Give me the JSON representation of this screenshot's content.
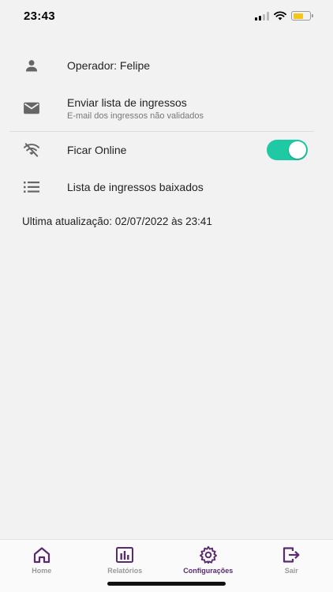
{
  "status_bar": {
    "time": "23:43"
  },
  "settings": {
    "operator": {
      "label": "Operador: Felipe",
      "icon": "person-icon"
    },
    "send_list": {
      "title": "Enviar lista de ingressos",
      "subtitle": "E-mail dos ingressos não validados",
      "icon": "mail-icon"
    },
    "stay_online": {
      "label": "Ficar Online",
      "icon": "wifi-off-icon",
      "enabled": true
    },
    "downloaded_list": {
      "label": "Lista de ingressos baixados",
      "icon": "list-icon"
    }
  },
  "last_update": "Ultima atualização: 02/07/2022 às 23:41",
  "tabbar": {
    "items": [
      {
        "label": "Home",
        "icon": "home-icon",
        "active": false
      },
      {
        "label": "Relatórios",
        "icon": "chart-icon",
        "active": false
      },
      {
        "label": "Configurações",
        "icon": "gear-icon",
        "active": true
      },
      {
        "label": "Sair",
        "icon": "logout-icon",
        "active": false
      }
    ]
  },
  "colors": {
    "accent": "#5a2a6e",
    "toggle_on": "#1ec9a3",
    "background": "#f2f2f2"
  }
}
